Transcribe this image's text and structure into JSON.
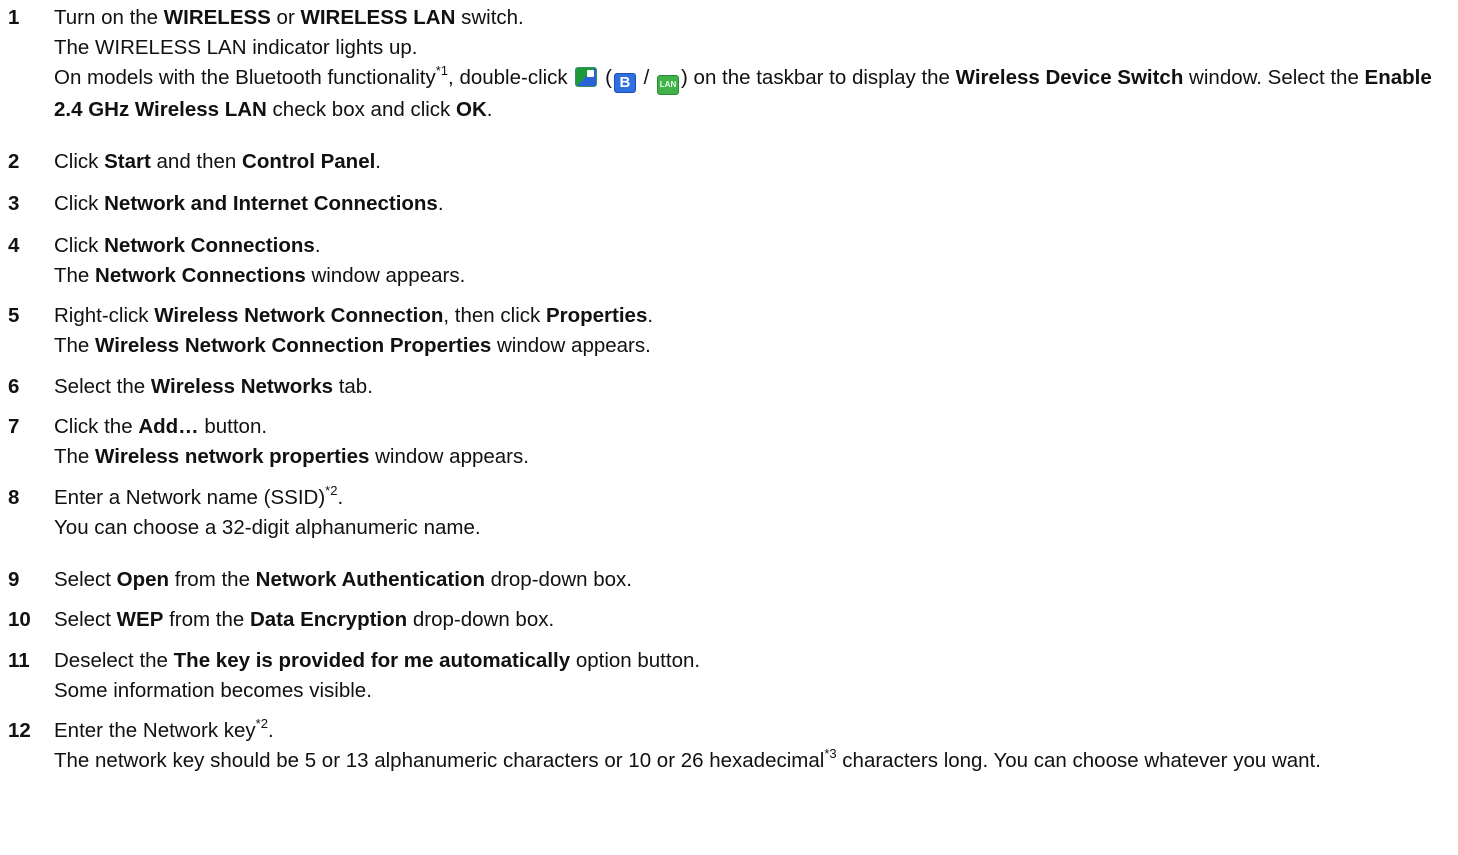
{
  "steps": [
    {
      "num": "1",
      "lines": [
        [
          "Turn on the ",
          {
            "b": "WIRELESS"
          },
          " or ",
          {
            "b": "WIRELESS LAN"
          },
          " switch."
        ],
        [
          "The WIRELESS LAN indicator lights up."
        ]
      ],
      "extra": [
        "On models with the Bluetooth functionality",
        {
          "sup": "*1"
        },
        ", double-click ",
        {
          "icon": "bluetooth-wlan-combo-icon"
        },
        " (",
        {
          "icon": "bluetooth-b-icon",
          "text": "B"
        },
        " / ",
        {
          "icon": "lan-icon",
          "text": "LAN"
        },
        ") on the taskbar to display the ",
        {
          "b": "Wireless Device Switch"
        },
        " window. Select the ",
        {
          "b": "Enable 2.4 GHz Wireless LAN"
        },
        " check box and click ",
        {
          "b": "OK"
        },
        "."
      ]
    },
    {
      "num": "2",
      "lines": [
        [
          "Click ",
          {
            "b": "Start"
          },
          " and then ",
          {
            "b": "Control Panel"
          },
          "."
        ]
      ]
    },
    {
      "num": "3",
      "lines": [
        [
          "Click ",
          {
            "b": "Network and Internet Connections"
          },
          "."
        ]
      ]
    },
    {
      "num": "4",
      "lines": [
        [
          "Click ",
          {
            "b": "Network Connections"
          },
          "."
        ],
        [
          "The ",
          {
            "b": "Network Connections"
          },
          " window appears."
        ]
      ]
    },
    {
      "num": "5",
      "lines": [
        [
          "Right-click ",
          {
            "b": "Wireless Network Connection"
          },
          ", then click ",
          {
            "b": "Properties"
          },
          "."
        ],
        [
          "The ",
          {
            "b": "Wireless Network Connection Properties"
          },
          " window appears."
        ]
      ]
    },
    {
      "num": "6",
      "lines": [
        [
          "Select the ",
          {
            "b": "Wireless Networks"
          },
          " tab."
        ]
      ]
    },
    {
      "num": "7",
      "lines": [
        [
          "Click the ",
          {
            "b": "Add…"
          },
          " button."
        ],
        [
          "The ",
          {
            "b": "Wireless network properties"
          },
          " window appears."
        ]
      ]
    },
    {
      "num": "8",
      "lines": [
        [
          "Enter a Network name (SSID)",
          {
            "sup": "*2"
          },
          "."
        ],
        [
          "You can choose a 32-digit alphanumeric name."
        ]
      ]
    },
    {
      "num": "9",
      "lines": [
        [
          "Select ",
          {
            "b": "Open"
          },
          " from the ",
          {
            "b": "Network Authentication"
          },
          " drop-down box."
        ]
      ]
    },
    {
      "num": "10",
      "lines": [
        [
          "Select ",
          {
            "b": "WEP"
          },
          " from the ",
          {
            "b": "Data Encryption"
          },
          " drop-down box."
        ]
      ]
    },
    {
      "num": "11",
      "lines": [
        [
          "Deselect the ",
          {
            "b": "The key is provided for me automatically"
          },
          " option button."
        ],
        [
          "Some information becomes visible."
        ]
      ]
    },
    {
      "num": "12",
      "lines": [
        [
          "Enter the Network key",
          {
            "sup": "*2"
          },
          "."
        ]
      ],
      "extra": [
        "The network key should be 5 or 13 alphanumeric characters or 10 or 26 hexadecimal",
        {
          "sup": "*3"
        },
        " characters long. You can choose whatever you want."
      ]
    }
  ]
}
